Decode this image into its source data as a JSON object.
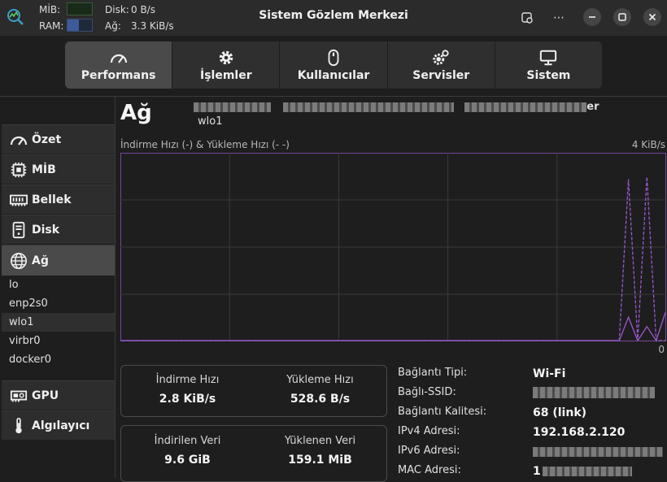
{
  "titlebar": {
    "title": "Sistem Gözlem Merkezi",
    "cpu_label": "MİB:",
    "ram_label": "RAM:",
    "disk_label": "Disk:",
    "disk_value": "0 B/s",
    "net_label": "Ağ:",
    "net_value": "3.3 KiB/s",
    "ram_fraction": 0.45
  },
  "tabs": [
    {
      "label": "Performans",
      "icon": "gauge-icon",
      "active": true
    },
    {
      "label": "İşlemler",
      "icon": "gear-icon"
    },
    {
      "label": "Kullanıcılar",
      "icon": "mouse-icon"
    },
    {
      "label": "Servisler",
      "icon": "gears-icon"
    },
    {
      "label": "Sistem",
      "icon": "monitor-icon"
    }
  ],
  "sidebar": {
    "items": [
      {
        "label": "Özet",
        "icon": "gauge-icon"
      },
      {
        "label": "MİB",
        "icon": "cpu-icon"
      },
      {
        "label": "Bellek",
        "icon": "memory-icon"
      },
      {
        "label": "Disk",
        "icon": "disk-icon"
      },
      {
        "label": "Ağ",
        "icon": "globe-icon",
        "active": true
      },
      {
        "label": "GPU",
        "icon": "gpu-icon"
      },
      {
        "label": "Algılayıcı",
        "icon": "thermometer-icon"
      }
    ],
    "interfaces": [
      "lo",
      "enp2s0",
      "wlo1",
      "virbr0",
      "docker0"
    ],
    "selected_interface": "wlo1"
  },
  "main": {
    "heading": "Ağ",
    "device_suffix": "er",
    "interface": "wlo1",
    "chart_label": "İndirme Hızı (-) & Yükleme Hızı (-  -)",
    "chart_max": "4 KiB/s",
    "chart_min": "0"
  },
  "chart_data": {
    "type": "line",
    "title": "İndirme Hızı (-) & Yükleme Hızı (-  -)",
    "ylim": [
      0,
      4
    ],
    "yunit": "KiB/s",
    "grid": true,
    "x": [
      0,
      1,
      2,
      3,
      4,
      5,
      6,
      7,
      8,
      9,
      10,
      11,
      12,
      13,
      14,
      15,
      16,
      17,
      18,
      19,
      20,
      21,
      22,
      23,
      24,
      25,
      26,
      27,
      28,
      29,
      30,
      31,
      32,
      33,
      34,
      35,
      36,
      37,
      38,
      39,
      40,
      41,
      42,
      43,
      44,
      45,
      46,
      47,
      48,
      49,
      50,
      51,
      52,
      53,
      54,
      55,
      56,
      57,
      58,
      59
    ],
    "series": [
      {
        "values": [
          0,
          0,
          0,
          0,
          0,
          0,
          0,
          0,
          0,
          0,
          0,
          0,
          0,
          0,
          0,
          0,
          0,
          0,
          0,
          0,
          0,
          0,
          0,
          0,
          0,
          0,
          0,
          0,
          0,
          0,
          0,
          0,
          0,
          0,
          0,
          0,
          0,
          0,
          0,
          0,
          0,
          0,
          0,
          0,
          0,
          0,
          0,
          0,
          0,
          0,
          0,
          0,
          0,
          0,
          0,
          0.5,
          0,
          0.3,
          0,
          0.6
        ],
        "style": "solid",
        "color": "#9b59d0"
      },
      {
        "values": [
          0,
          0,
          0,
          0,
          0,
          0,
          0,
          0,
          0,
          0,
          0,
          0,
          0,
          0,
          0,
          0,
          0,
          0,
          0,
          0,
          0,
          0,
          0,
          0,
          0,
          0,
          0,
          0,
          0,
          0,
          0,
          0,
          0,
          0,
          0,
          0,
          0,
          0,
          0,
          0,
          0,
          0,
          0,
          0,
          0,
          0,
          0,
          0,
          0,
          0,
          0,
          0,
          0,
          0,
          0,
          3.45,
          0,
          3.5,
          0,
          0
        ],
        "style": "dashed",
        "color": "#9b59d0"
      }
    ]
  },
  "stats": {
    "download_speed_label": "İndirme Hızı",
    "download_speed_value": "2.8 KiB/s",
    "upload_speed_label": "Yükleme Hızı",
    "upload_speed_value": "528.6 B/s",
    "downloaded_label": "İndirilen Veri",
    "downloaded_value": "9.6 GiB",
    "uploaded_label": "Yüklenen Veri",
    "uploaded_value": "159.1 MiB"
  },
  "properties": [
    {
      "label": "Bağlantı Tipi:",
      "value": "Wi-Fi"
    },
    {
      "label": "Bağlı-SSID:",
      "value": ""
    },
    {
      "label": "Bağlantı Kalitesi:",
      "value": "68 (link)"
    },
    {
      "label": "IPv4 Adresi:",
      "value": "192.168.2.120"
    },
    {
      "label": "IPv6 Adresi:",
      "value": ""
    },
    {
      "label": "MAC Adresi:",
      "value": "1"
    }
  ],
  "colors": {
    "accent": "#9b59d0",
    "background": "#1e1e1e",
    "active_tab": "#4a4a4a"
  }
}
